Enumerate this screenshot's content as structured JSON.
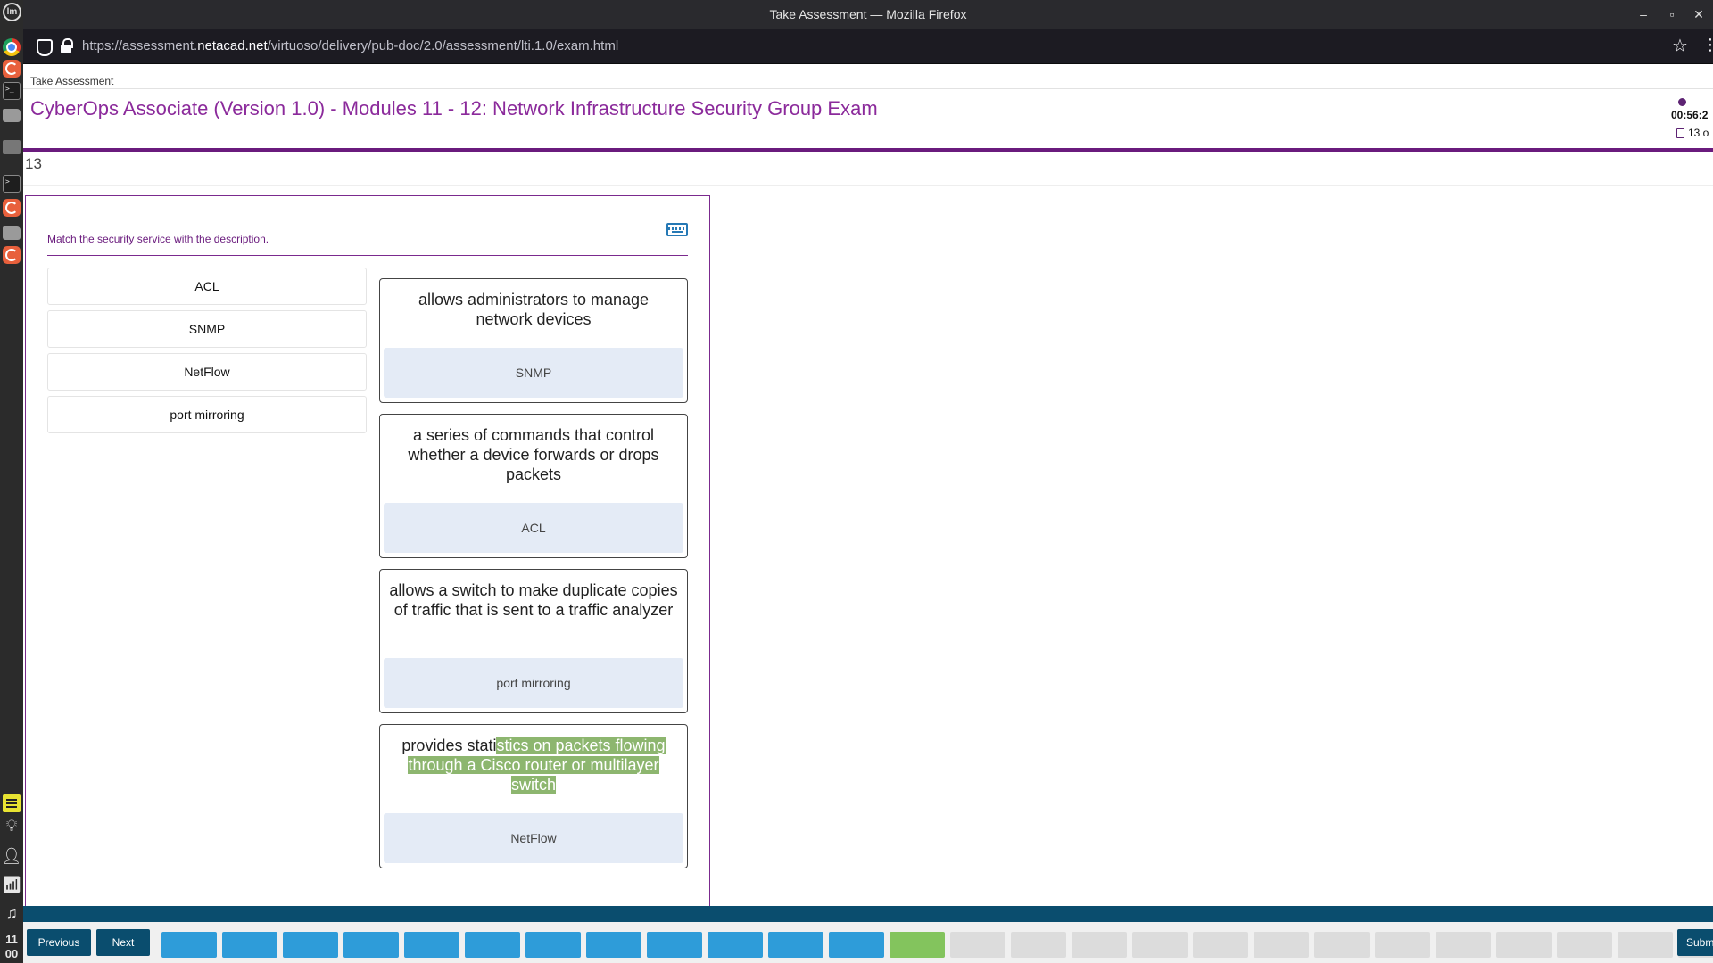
{
  "os_panel": {
    "clock_hour": "11",
    "clock_minute": "00"
  },
  "window": {
    "title": "Take Assessment — Mozilla Firefox",
    "minimize_glyph": "–",
    "maximize_glyph": "▫",
    "close_glyph": "✕"
  },
  "browser": {
    "url_prefix": "https://assessment.",
    "url_domain": "netacad.net",
    "url_path": "/virtuoso/delivery/pub-doc/2.0/assessment/lti.1.0/exam.html"
  },
  "page": {
    "breadcrumb": "Take Assessment",
    "exam_title": "CyberOps Associate (Version 1.0) - Modules 11 - 12: Network Infrastructure Security Group Exam",
    "timer": "00:56:2",
    "question_count": "13 o",
    "question_number": "13"
  },
  "question": {
    "instruction": "Match the security service with the description.",
    "options": [
      {
        "label": "ACL"
      },
      {
        "label": "SNMP"
      },
      {
        "label": "NetFlow"
      },
      {
        "label": "port mirroring"
      }
    ],
    "targets": [
      {
        "description": "allows administrators to manage network devices",
        "answer": "SNMP"
      },
      {
        "description": "a series of commands that control whether a device forwards or drops packets",
        "answer": "ACL"
      },
      {
        "description": "allows a switch to make duplicate copies of traffic that is sent to a traffic analyzer",
        "answer": "port mirroring"
      },
      {
        "description_plain": "provides stati",
        "description_highlighted": "stics on packets flowing through a Cisco router or multilayer switch",
        "answer": "NetFlow"
      }
    ]
  },
  "footer": {
    "previous_label": "Previous",
    "next_label": "Next",
    "submit_label": "Submit",
    "question_states": [
      "answered",
      "answered",
      "answered",
      "answered",
      "answered",
      "answered",
      "answered",
      "answered",
      "answered",
      "answered",
      "answered",
      "answered",
      "current",
      "unanswered",
      "unanswered",
      "unanswered",
      "unanswered",
      "unanswered",
      "unanswered",
      "unanswered",
      "unanswered",
      "unanswered",
      "unanswered",
      "unanswered",
      "unanswered",
      "unanswered",
      "unanswered"
    ]
  },
  "colors": {
    "brand_purple": "#8b2a9b",
    "nav_blue": "#0a4d6e",
    "answered_blue": "#2e9cd9",
    "current_green": "#83c45d",
    "highlight_green": "#8db66f"
  }
}
